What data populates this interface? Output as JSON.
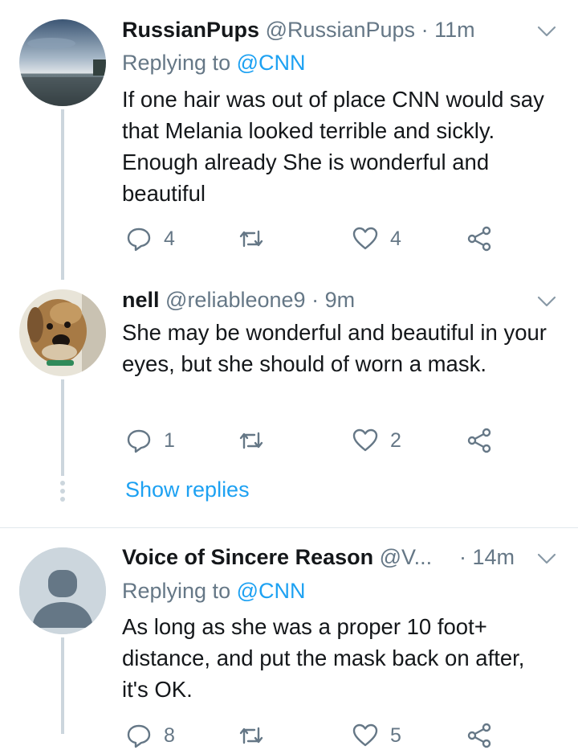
{
  "tweets": [
    {
      "name": "RussianPups",
      "handle": "@RussianPups",
      "time": "· 11m",
      "replying_prefix": "Replying to ",
      "replying_to": "@CNN",
      "text": "If one hair was out of place CNN would say that Melania looked terrible and sickly. Enough already She is wonderful and beautiful",
      "replies": "4",
      "retweets": "",
      "likes": "4"
    },
    {
      "name": "nell",
      "handle": "@reliableone9",
      "time": "· 9m",
      "text": "She may be wonderful and beautiful in your eyes, but she should of worn a mask.",
      "replies": "1",
      "retweets": "",
      "likes": "2"
    },
    {
      "name": "Voice of Sincere Reason",
      "handle": "@V...",
      "time": "· 14m",
      "replying_prefix": "Replying to ",
      "replying_to": "@CNN",
      "text": "As long as she was a proper 10 foot+ distance, and put the mask back on after, it's OK.",
      "replies": "8",
      "retweets": "",
      "likes": "5"
    }
  ],
  "show_replies": "Show replies",
  "icons": {
    "reply": "reply-icon",
    "retweet": "retweet-icon",
    "like": "heart-icon",
    "share": "share-icon",
    "menu": "chevron-down-icon"
  },
  "colors": {
    "link": "#1da1f2",
    "muted": "#657786",
    "text": "#14171a",
    "thread_line": "#ccd6dd"
  }
}
